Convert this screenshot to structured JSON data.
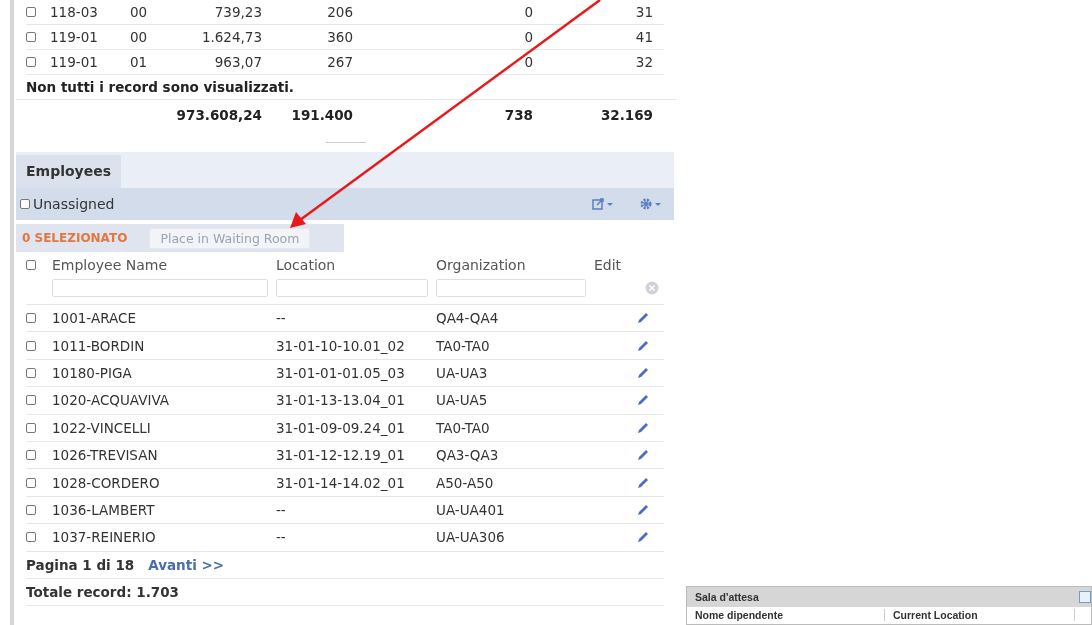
{
  "summary_table": {
    "rows": [
      {
        "selected": false,
        "cells": [
          "118-03",
          "00",
          "739,23",
          "206",
          "0",
          "31"
        ]
      },
      {
        "selected": false,
        "cells": [
          "119-01",
          "00",
          "1.624,73",
          "360",
          "0",
          "41"
        ]
      },
      {
        "selected": false,
        "cells": [
          "119-01",
          "01",
          "963,07",
          "267",
          "0",
          "32"
        ]
      }
    ],
    "notice": "Non tutti i record sono visualizzati.",
    "totals": [
      "973.608,24",
      "191.400",
      "738",
      "32.169"
    ]
  },
  "employees": {
    "tabs": [
      {
        "label": "Employees",
        "selected": true
      }
    ],
    "unassigned": {
      "label": "Unassigned",
      "checked": false
    },
    "selection_count": "0 SELEZIONATO",
    "place_button": {
      "label": "Place in Waiting Room",
      "disabled": true
    },
    "columns": [
      "Employee Name",
      "Location",
      "Organization",
      "Edit"
    ],
    "header_checked": false,
    "rows": [
      {
        "selected": false,
        "name": "1001-ARACE",
        "location": "--",
        "organization": "QA4-QA4"
      },
      {
        "selected": false,
        "name": "1011-BORDIN",
        "location": "31-01-10-10.01_02",
        "organization": "TA0-TA0"
      },
      {
        "selected": false,
        "name": "10180-PIGA",
        "location": "31-01-01-01.05_03",
        "organization": "UA-UA3"
      },
      {
        "selected": false,
        "name": "1020-ACQUAVIVA",
        "location": "31-01-13-13.04_01",
        "organization": "UA-UA5"
      },
      {
        "selected": false,
        "name": "1022-VINCELLI",
        "location": "31-01-09-09.24_01",
        "organization": "TA0-TA0"
      },
      {
        "selected": false,
        "name": "1026-TREVISAN",
        "location": "31-01-12-12.19_01",
        "organization": "QA3-QA3"
      },
      {
        "selected": false,
        "name": "1028-CORDERO",
        "location": "31-01-14-14.02_01",
        "organization": "A50-A50"
      },
      {
        "selected": false,
        "name": "1036-LAMBERT",
        "location": "--",
        "organization": "UA-UA401"
      },
      {
        "selected": false,
        "name": "1037-REINERIO",
        "location": "--",
        "organization": "UA-UA306"
      }
    ],
    "pager": {
      "page": "Pagina 1 di 18",
      "next": "Avanti >>"
    },
    "total": "Totale record: 1.703"
  },
  "waiting_room": {
    "title": "Sala d'attesa",
    "columns": [
      "Nome dipendente",
      "Current Location"
    ]
  }
}
